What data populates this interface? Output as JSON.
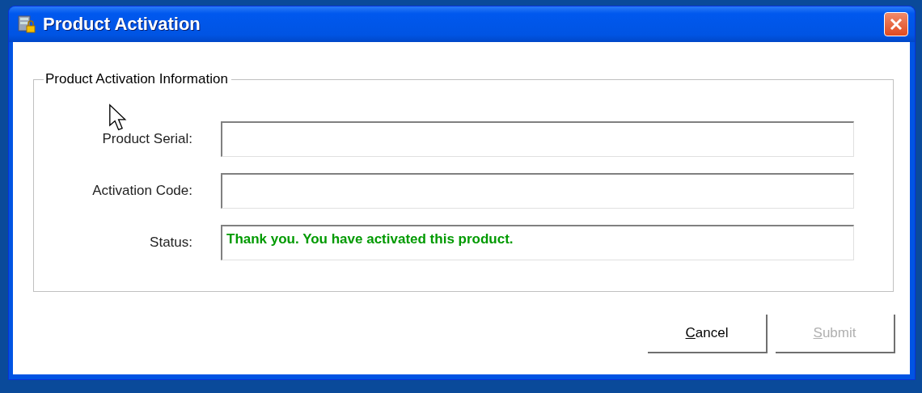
{
  "window": {
    "title": "Product Activation"
  },
  "group": {
    "title": "Product Activation Information"
  },
  "fields": [
    {
      "label": "Product Serial:",
      "kind": "input"
    },
    {
      "label": "Activation Code:",
      "kind": "input"
    },
    {
      "label": "Status:",
      "value": "Thank you. You have activated this product.",
      "kind": "status"
    }
  ],
  "buttons": [
    {
      "mnemonic": "C",
      "label_rest": "ancel",
      "disabled": false
    },
    {
      "mnemonic": "S",
      "label_rest": "ubmit",
      "disabled": true
    }
  ]
}
